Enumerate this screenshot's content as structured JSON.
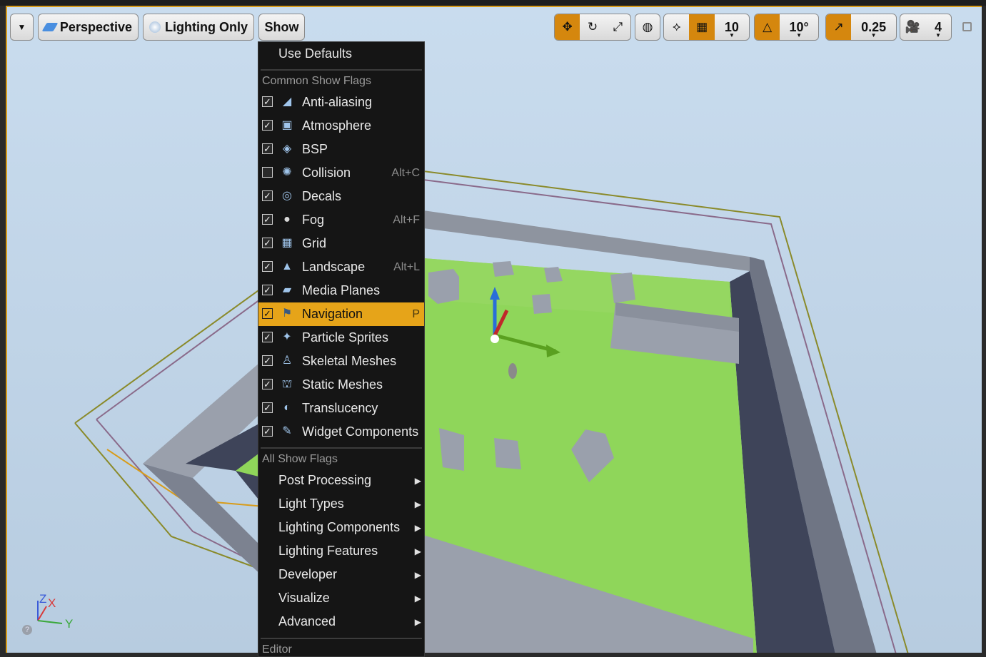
{
  "toolbar": {
    "dropdown_icon": "chevron-down-icon",
    "perspective_label": "Perspective",
    "lighting_label": "Lighting Only",
    "show_label": "Show",
    "grid_snap_value": "10",
    "rotation_snap_value": "10°",
    "scale_snap_value": "0.25",
    "camera_speed_value": "4",
    "accent_color": "#d5870e"
  },
  "menu": {
    "use_defaults": "Use Defaults",
    "common_header": "Common Show Flags",
    "common_items": [
      {
        "label": "Anti-aliasing",
        "checked": true,
        "shortcut": "",
        "icon": "antialiasing-icon"
      },
      {
        "label": "Atmosphere",
        "checked": true,
        "shortcut": "",
        "icon": "atmosphere-icon"
      },
      {
        "label": "BSP",
        "checked": true,
        "shortcut": "",
        "icon": "bsp-icon"
      },
      {
        "label": "Collision",
        "checked": false,
        "shortcut": "Alt+C",
        "icon": "collision-icon"
      },
      {
        "label": "Decals",
        "checked": true,
        "shortcut": "",
        "icon": "decals-icon"
      },
      {
        "label": "Fog",
        "checked": true,
        "shortcut": "Alt+F",
        "icon": "fog-icon"
      },
      {
        "label": "Grid",
        "checked": true,
        "shortcut": "",
        "icon": "grid-icon"
      },
      {
        "label": "Landscape",
        "checked": true,
        "shortcut": "Alt+L",
        "icon": "landscape-icon"
      },
      {
        "label": "Media Planes",
        "checked": true,
        "shortcut": "",
        "icon": "media-planes-icon"
      },
      {
        "label": "Navigation",
        "checked": true,
        "shortcut": "P",
        "icon": "navigation-icon",
        "highlighted": true
      },
      {
        "label": "Particle Sprites",
        "checked": true,
        "shortcut": "",
        "icon": "particle-sprites-icon"
      },
      {
        "label": "Skeletal Meshes",
        "checked": true,
        "shortcut": "",
        "icon": "skeletal-meshes-icon"
      },
      {
        "label": "Static Meshes",
        "checked": true,
        "shortcut": "",
        "icon": "static-meshes-icon"
      },
      {
        "label": "Translucency",
        "checked": true,
        "shortcut": "",
        "icon": "translucency-icon"
      },
      {
        "label": "Widget Components",
        "checked": true,
        "shortcut": "",
        "icon": "widget-components-icon"
      }
    ],
    "all_header": "All Show Flags",
    "all_items": [
      {
        "label": "Post Processing"
      },
      {
        "label": "Light Types"
      },
      {
        "label": "Lighting Components"
      },
      {
        "label": "Lighting Features"
      },
      {
        "label": "Developer"
      },
      {
        "label": "Visualize"
      },
      {
        "label": "Advanced"
      }
    ],
    "editor_header": "Editor",
    "highlight_color": "#e6a419"
  },
  "axes": {
    "z": "Z",
    "x": "X",
    "y": "Y"
  }
}
